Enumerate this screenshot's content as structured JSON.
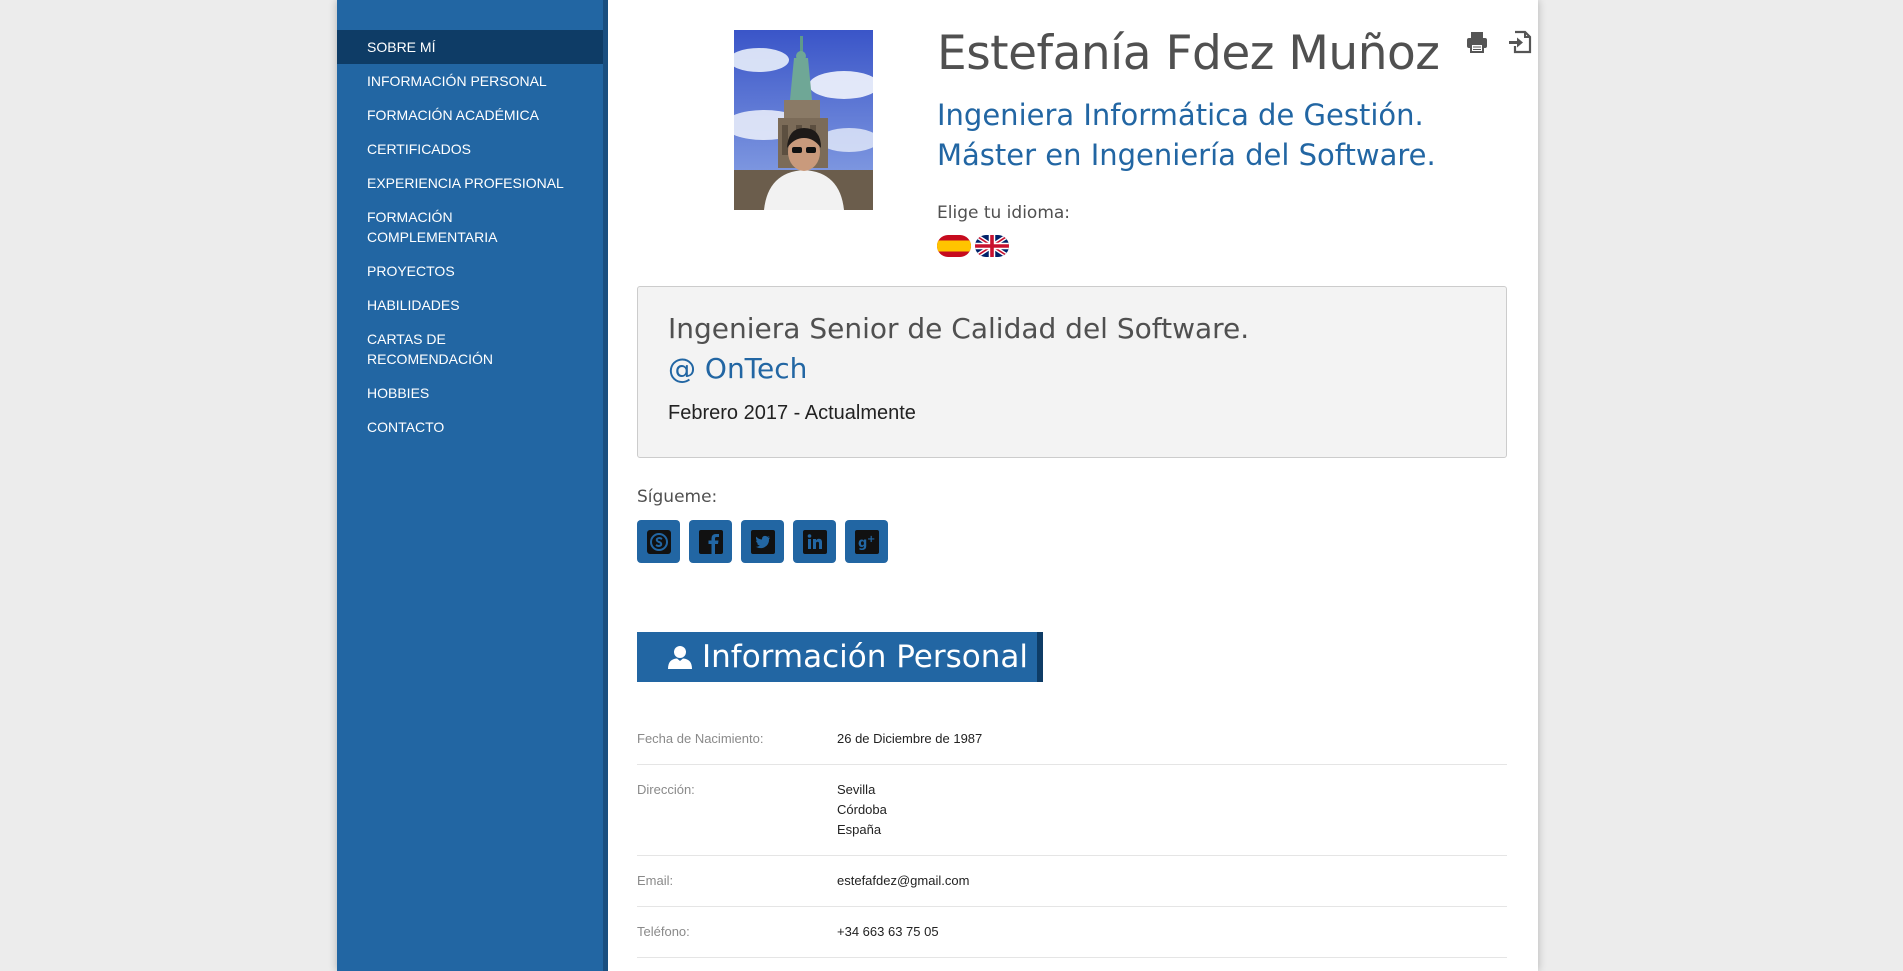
{
  "sidebar": {
    "items": [
      {
        "label": "SOBRE MÍ"
      },
      {
        "label": "INFORMACIÓN PERSONAL"
      },
      {
        "label": "FORMACIÓN ACADÉMICA"
      },
      {
        "label": "CERTIFICADOS"
      },
      {
        "label": "EXPERIENCIA PROFESIONAL"
      },
      {
        "label": "FORMACIÓN COMPLEMENTARIA"
      },
      {
        "label": "PROYECTOS"
      },
      {
        "label": "HABILIDADES"
      },
      {
        "label": "CARTAS DE RECOMENDACIÓN"
      },
      {
        "label": "HOBBIES"
      },
      {
        "label": "CONTACTO"
      }
    ]
  },
  "profile": {
    "name": "Estefanía Fdez Muñoz",
    "subtitle_line1": "Ingeniera Informática de Gestión.",
    "subtitle_line2": "Máster en Ingeniería del Software.",
    "language_label": "Elige tu idioma:"
  },
  "current_job": {
    "title": "Ingeniera Senior de Calidad del Software.",
    "company": "@ OnTech",
    "dates": "Febrero 2017 - Actualmente"
  },
  "social": {
    "label": "Sígueme:"
  },
  "personal_info": {
    "heading": "Información Personal",
    "birth_label": "Fecha de Nacimiento:",
    "birth_value": "26 de Diciembre de 1987",
    "address_label": "Dirección:",
    "address_line1": "Sevilla",
    "address_line2": "Córdoba",
    "address_line3": "España",
    "email_label": "Email:",
    "email_value": "estefafdez@gmail.com",
    "phone_label": "Teléfono:",
    "phone_value": "+34 663 63 75 05"
  },
  "colors": {
    "accent": "#2266a3",
    "accent_dark": "#0e3c66",
    "page_bg": "#ececec"
  },
  "icons": [
    "print-icon",
    "export-icon",
    "spain-flag-icon",
    "uk-flag-icon",
    "skype-icon",
    "facebook-icon",
    "twitter-icon",
    "linkedin-icon",
    "google-plus-icon",
    "user-icon"
  ]
}
